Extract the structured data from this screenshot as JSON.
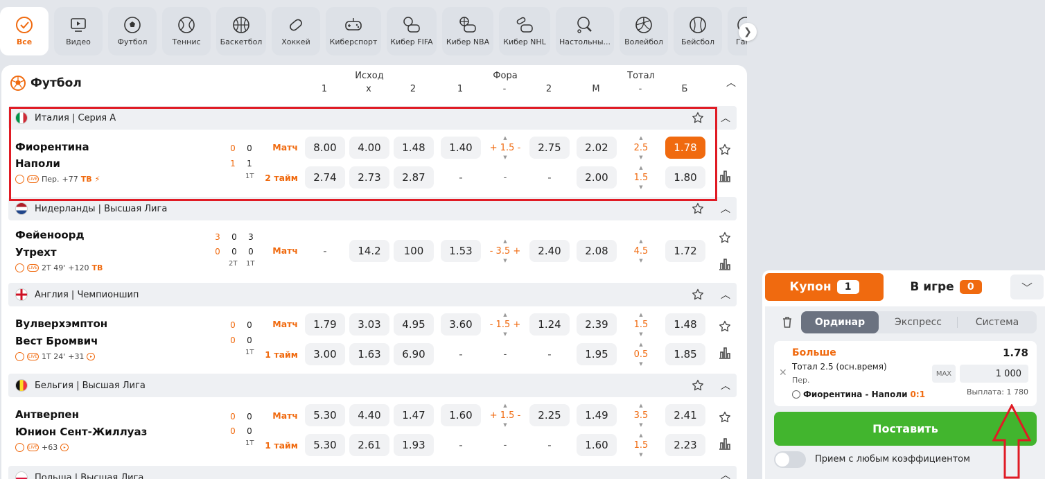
{
  "sports": [
    {
      "label": "Все",
      "icon": "check-circle-icon"
    },
    {
      "label": "Видео",
      "icon": "video-icon"
    },
    {
      "label": "Футбол",
      "icon": "soccer-ball-icon"
    },
    {
      "label": "Теннис",
      "icon": "tennis-ball-icon"
    },
    {
      "label": "Баскетбол",
      "icon": "basketball-icon"
    },
    {
      "label": "Хоккей",
      "icon": "hockey-puck-icon"
    },
    {
      "label": "Киберспорт",
      "icon": "gamepad-icon"
    },
    {
      "label": "Кибер FIFA",
      "icon": "cyber-fifa-icon"
    },
    {
      "label": "Кибер NBA",
      "icon": "cyber-nba-icon"
    },
    {
      "label": "Кибер NHL",
      "icon": "cyber-nhl-icon"
    },
    {
      "label": "Настольны...",
      "icon": "table-tennis-icon"
    },
    {
      "label": "Волейбол",
      "icon": "volleyball-icon"
    },
    {
      "label": "Бейсбол",
      "icon": "baseball-icon"
    },
    {
      "label": "Ган",
      "icon": "handball-icon"
    }
  ],
  "section": {
    "title": "Футбол",
    "groups": [
      "Исход",
      "Фора",
      "Тотал"
    ],
    "cols": [
      "1",
      "x",
      "2",
      "1",
      "-",
      "2",
      "М",
      "-",
      "Б"
    ]
  },
  "leagues": [
    {
      "name": "Италия | Серия А",
      "flag": "it"
    },
    {
      "name": "Нидерланды | Высшая Лига",
      "flag": "nl"
    },
    {
      "name": "Англия | Чемпионшип",
      "flag": "en"
    },
    {
      "name": "Бельгия | Высшая Лига",
      "flag": "be"
    },
    {
      "name": "Польша | Высшая Лига",
      "flag": "pl"
    }
  ],
  "matches": [
    {
      "team1": "Фиорентина",
      "team2": "Наполи",
      "scores": [
        [
          "0",
          "0"
        ],
        [
          "1",
          "1"
        ]
      ],
      "periods": [
        "1Т"
      ],
      "meta_period": "Пер.",
      "meta_more": "+77",
      "meta_tv": "ТВ",
      "rows": [
        {
          "type": "Матч",
          "odds": [
            "8.00",
            "4.00",
            "1.48",
            "1.40",
            "+ 1.5 -",
            "2.75",
            "2.02",
            "2.5",
            "1.78"
          ]
        },
        {
          "type": "2 тайм",
          "odds": [
            "2.74",
            "2.73",
            "2.87",
            "-",
            "-",
            "-",
            "2.00",
            "1.5",
            "1.80"
          ]
        }
      ]
    },
    {
      "team1": "Фейеноорд",
      "team2": "Утрехт",
      "scores": [
        [
          "3",
          "0",
          "3"
        ],
        [
          "0",
          "0",
          "0"
        ]
      ],
      "periods": [
        "2Т",
        "1Т"
      ],
      "meta_period": "2Т 49'",
      "meta_more": "+120",
      "meta_tv": "ТВ",
      "rows": [
        {
          "type": "Матч",
          "odds": [
            "-",
            "14.2",
            "100",
            "1.53",
            "- 3.5 +",
            "2.40",
            "2.08",
            "4.5",
            "1.72"
          ]
        }
      ]
    },
    {
      "team1": "Вулверхэмптон",
      "team2": "Вест Бромвич",
      "scores": [
        [
          "0",
          "0"
        ],
        [
          "0",
          "0"
        ]
      ],
      "periods": [
        "1Т"
      ],
      "meta_period": "1Т 24'",
      "meta_more": "+31",
      "meta_tv": "",
      "rows": [
        {
          "type": "Матч",
          "odds": [
            "1.79",
            "3.03",
            "4.95",
            "3.60",
            "- 1.5 +",
            "1.24",
            "2.39",
            "1.5",
            "1.48"
          ]
        },
        {
          "type": "1 тайм",
          "odds": [
            "3.00",
            "1.63",
            "6.90",
            "-",
            "-",
            "-",
            "1.95",
            "0.5",
            "1.85"
          ]
        }
      ]
    },
    {
      "team1": "Антверпен",
      "team2": "Юнион Сент-Жиллуаз",
      "scores": [
        [
          "0",
          "0"
        ],
        [
          "0",
          "0"
        ]
      ],
      "periods": [
        "1Т"
      ],
      "meta_period": "",
      "meta_more": "+63",
      "meta_tv": "",
      "rows": [
        {
          "type": "Матч",
          "odds": [
            "5.30",
            "4.40",
            "1.47",
            "1.60",
            "+ 1.5 -",
            "2.25",
            "1.49",
            "3.5",
            "2.41"
          ]
        },
        {
          "type": "1 тайм",
          "odds": [
            "5.30",
            "2.61",
            "1.93",
            "-",
            "-",
            "-",
            "1.60",
            "1.5",
            "2.23"
          ]
        }
      ]
    }
  ],
  "coupon": {
    "tab_coupon": "Купон",
    "coupon_count": "1",
    "tab_ingame": "В игре",
    "ingame_count": "0",
    "types": [
      "Ординар",
      "Экспресс",
      "Система"
    ],
    "bet": {
      "title": "Больше",
      "coef": "1.78",
      "market": "Тотал 2.5 (осн.время)",
      "period": "Пер.",
      "match": "Фиорентина - Наполи",
      "score": "0:1",
      "max_label": "MAX",
      "stake": "1 000",
      "payout": "Выплата: 1 780"
    },
    "place_label": "Поставить",
    "any_coef_label": "Прием с любым коэффициентом"
  },
  "colors": {
    "accent": "#f06a0f",
    "green": "#42b52e",
    "highlight": "#e01b24"
  }
}
